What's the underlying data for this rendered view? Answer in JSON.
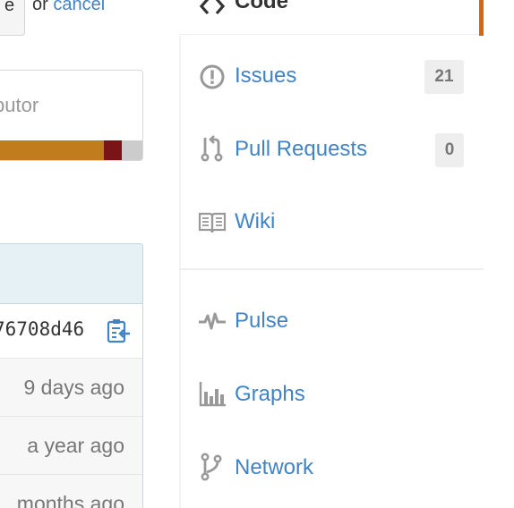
{
  "form": {
    "button_label": "e",
    "or_text": "or",
    "cancel_label": "cancel"
  },
  "contributors": {
    "label": "butor",
    "languages": [
      {
        "share": 0.74,
        "color": "#c07c1d"
      },
      {
        "share": 0.12,
        "color": "#7a1416"
      },
      {
        "share": 0.14,
        "color": "#cccccc"
      }
    ]
  },
  "commit": {
    "sha": "76708d46",
    "ages": [
      "9 days ago",
      "a year ago",
      "months ago"
    ]
  },
  "nav": {
    "code_label": "Code",
    "code_icon": "code-icon",
    "accent_color": "#d26911",
    "items": [
      {
        "label": "Issues",
        "icon": "issue-opened-icon",
        "count": "21"
      },
      {
        "label": "Pull Requests",
        "icon": "git-pull-request-icon",
        "count": "0"
      },
      {
        "label": "Wiki",
        "icon": "book-icon"
      },
      {
        "label": "Pulse",
        "icon": "pulse-icon"
      },
      {
        "label": "Graphs",
        "icon": "graph-icon"
      },
      {
        "label": "Network",
        "icon": "git-branch-icon"
      }
    ]
  }
}
